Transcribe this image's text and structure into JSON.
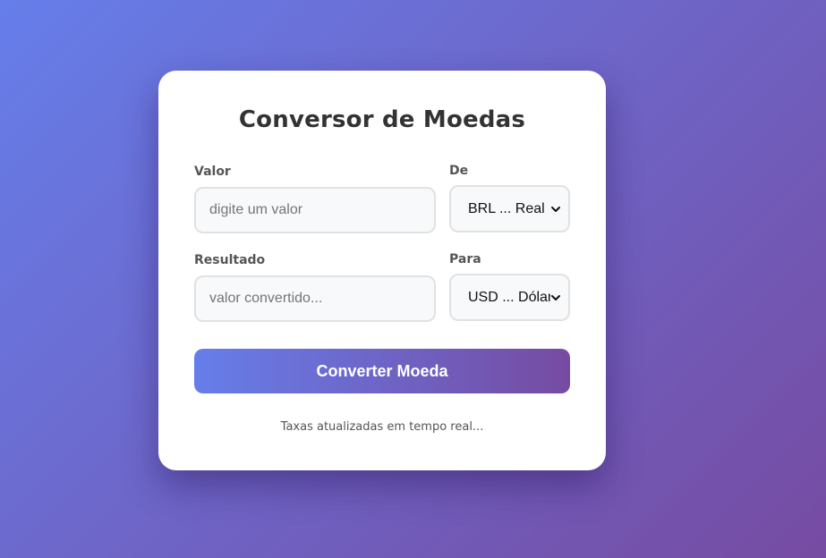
{
  "app": {
    "title": "Conversor de Moedas"
  },
  "form": {
    "valor": {
      "label": "Valor",
      "value": "",
      "placeholder": "digite um valor"
    },
    "de": {
      "label": "De",
      "selected": "BRL ... Real"
    },
    "resultado": {
      "label": "Resultado",
      "value": "",
      "placeholder": "valor convertido..."
    },
    "para": {
      "label": "Para",
      "selected": "USD ... Dólar"
    }
  },
  "actions": {
    "convert_label": "Converter Moeda"
  },
  "footer": {
    "note": "Taxas atualizadas em tempo real..."
  },
  "colors": {
    "gradient_start": "#667eea",
    "gradient_end": "#764ba2",
    "card_bg": "#ffffff",
    "text_dark": "#333333",
    "label_text": "#555555"
  },
  "icons": {
    "select_arrow": "chevron-down-icon"
  }
}
